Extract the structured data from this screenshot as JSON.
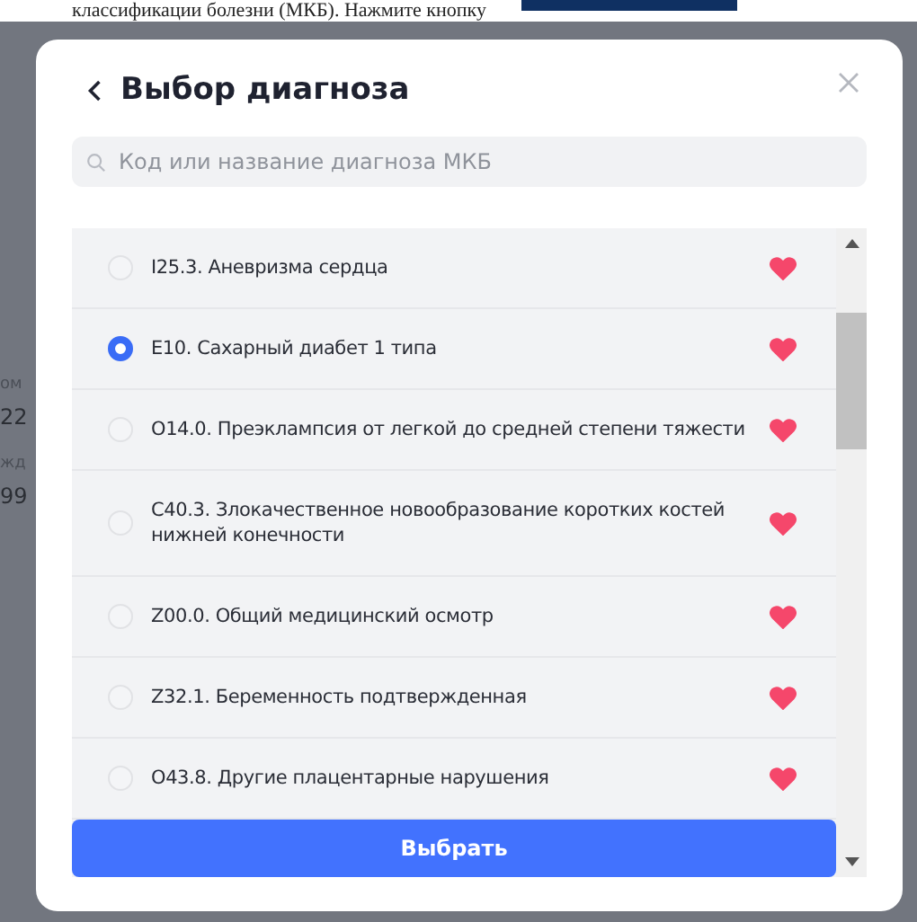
{
  "background": {
    "text": "классификации болезни (МКБ). Нажмите кнопку",
    "fragments": [
      "ом",
      "22",
      "жд",
      "99"
    ]
  },
  "dialog": {
    "title": "Выбор диагноза",
    "search": {
      "placeholder": "Код или название диагноза МКБ"
    },
    "items": [
      {
        "label": "I25.3. Аневризма сердца",
        "selected": false,
        "favorite": true
      },
      {
        "label": "E10. Сахарный диабет 1 типа",
        "selected": true,
        "favorite": true
      },
      {
        "label": "O14.0. Преэклампсия от легкой до средней степени тяжести",
        "selected": false,
        "favorite": true
      },
      {
        "label": "C40.3. Злокачественное новообразование коротких костей нижней конечности",
        "selected": false,
        "favorite": true
      },
      {
        "label": "Z00.0. Общий медицинский осмотр",
        "selected": false,
        "favorite": true
      },
      {
        "label": "Z32.1. Беременность подтвержденная",
        "selected": false,
        "favorite": true
      },
      {
        "label": "O43.8. Другие плацентарные нарушения",
        "selected": false,
        "favorite": true
      }
    ],
    "button": "Выбрать"
  }
}
